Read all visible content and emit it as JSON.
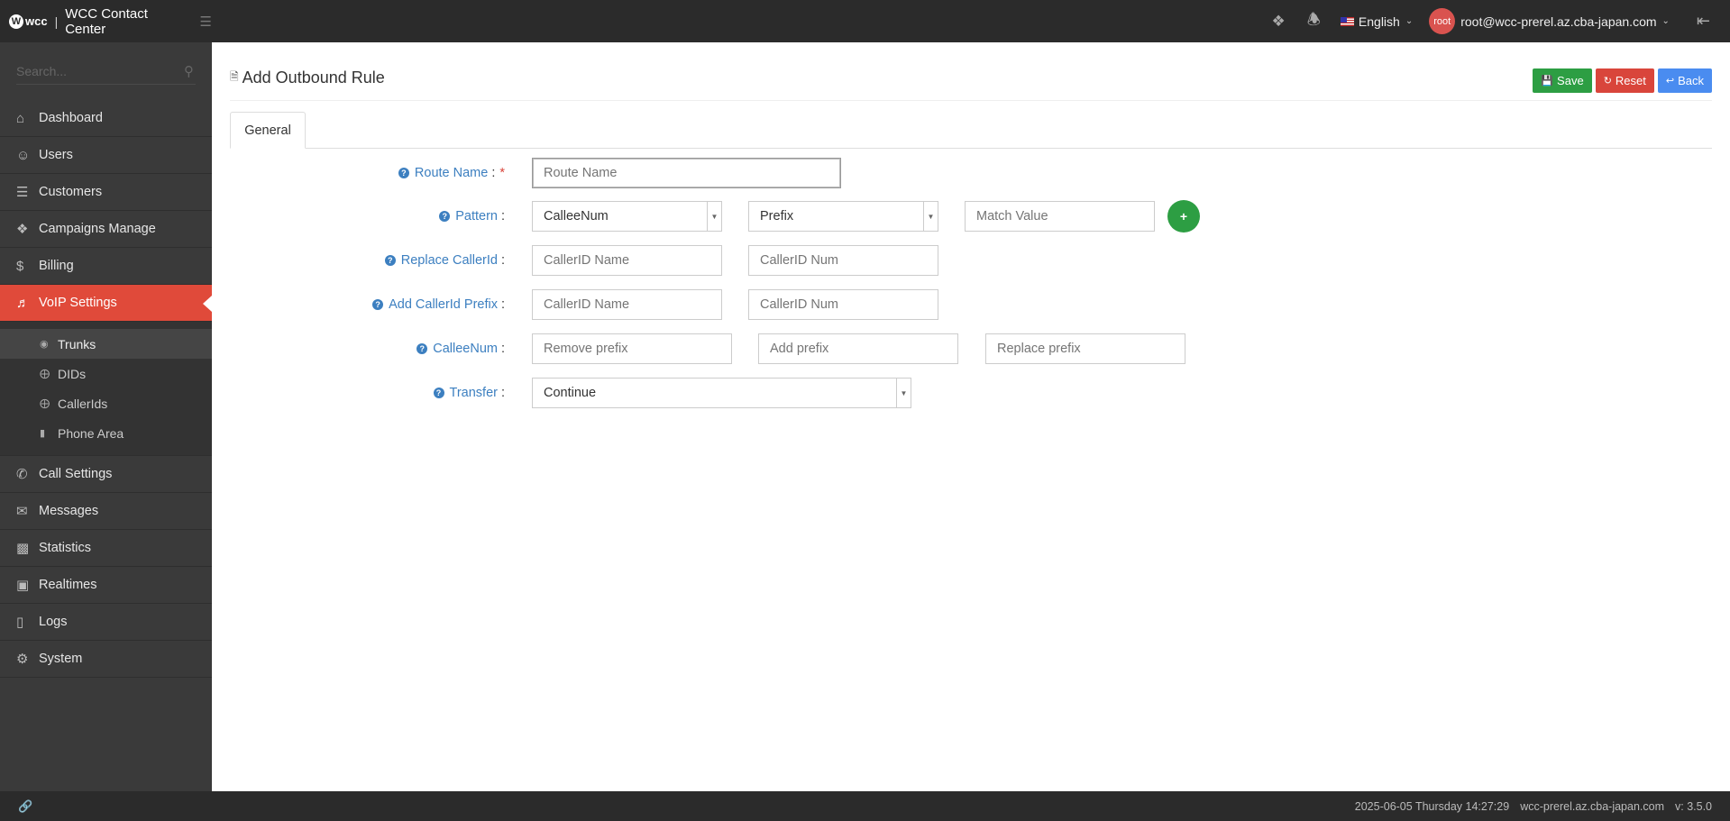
{
  "header": {
    "logo_text": "wcc",
    "app_title": "WCC Contact Center",
    "language": "English",
    "avatar_text": "root",
    "user_email": "root@wcc-prerel.az.cba-japan.com"
  },
  "sidebar": {
    "search_placeholder": "Search...",
    "items": [
      {
        "label": "Dashboard",
        "icon": "home-icon"
      },
      {
        "label": "Users",
        "icon": "user-icon"
      },
      {
        "label": "Customers",
        "icon": "database-icon"
      },
      {
        "label": "Campaigns Manage",
        "icon": "layers-icon"
      },
      {
        "label": "Billing",
        "icon": "dollar-icon"
      },
      {
        "label": "VoIP Settings",
        "icon": "volume-icon"
      },
      {
        "label": "Call Settings",
        "icon": "phone-icon"
      },
      {
        "label": "Messages",
        "icon": "envelope-icon"
      },
      {
        "label": "Statistics",
        "icon": "bar-chart-icon"
      },
      {
        "label": "Realtimes",
        "icon": "monitor-icon"
      },
      {
        "label": "Logs",
        "icon": "book-icon"
      },
      {
        "label": "System",
        "icon": "gear-icon"
      }
    ],
    "subitems": [
      {
        "label": "Trunks",
        "icon": "dashboard-icon"
      },
      {
        "label": "DIDs",
        "icon": "crosshair-icon"
      },
      {
        "label": "CallerIds",
        "icon": "crosshair-icon"
      },
      {
        "label": "Phone Area",
        "icon": "book-icon"
      }
    ]
  },
  "page": {
    "title": "Add Outbound Rule",
    "buttons": {
      "save": "Save",
      "reset": "Reset",
      "back": "Back"
    },
    "tab": "General"
  },
  "form": {
    "route_name": {
      "label": "Route Name",
      "placeholder": "Route Name"
    },
    "pattern": {
      "label": "Pattern",
      "field": "CalleeNum",
      "type": "Prefix",
      "match_placeholder": "Match Value",
      "add_label": "+"
    },
    "replace_callerid": {
      "label": "Replace CallerId",
      "name_placeholder": "CallerID Name",
      "num_placeholder": "CallerID Num"
    },
    "add_callerid_prefix": {
      "label": "Add CallerId Prefix",
      "name_placeholder": "CallerID Name",
      "num_placeholder": "CallerID Num"
    },
    "calleenum": {
      "label": "CalleeNum",
      "remove_placeholder": "Remove prefix",
      "add_placeholder": "Add prefix",
      "replace_placeholder": "Replace prefix"
    },
    "transfer": {
      "label": "Transfer",
      "value": "Continue"
    }
  },
  "footer": {
    "datetime": "2025-06-05 Thursday 14:27:29",
    "host": "wcc-prerel.az.cba-japan.com",
    "version": "v: 3.5.0"
  },
  "colors": {
    "accent_red": "#e04a3a",
    "save_green": "#2d9e43",
    "back_blue": "#4a8cf0",
    "label_blue": "#3c7fc0"
  }
}
